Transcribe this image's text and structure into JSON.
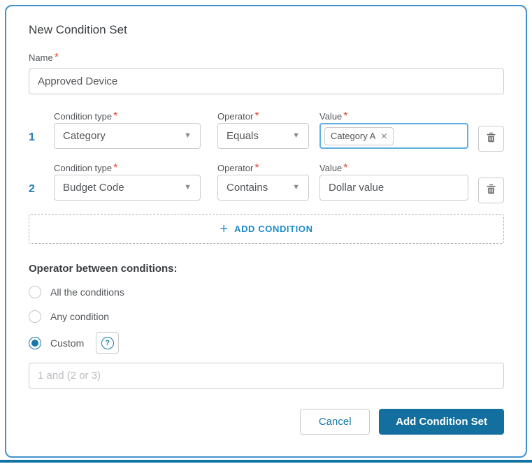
{
  "dialog": {
    "title": "New Condition Set",
    "required_mark": "*",
    "name_field": {
      "label": "Name",
      "value": "Approved Device"
    },
    "columns": {
      "condition_type": "Condition type",
      "operator": "Operator",
      "value": "Value"
    },
    "conditions": [
      {
        "index": "1",
        "condition_type": "Category",
        "operator": "Equals",
        "chip": "Category A"
      },
      {
        "index": "2",
        "condition_type": "Budget Code",
        "operator": "Contains",
        "value": "Dollar value"
      }
    ],
    "add_condition_label": "ADD CONDITION",
    "operator_between": {
      "label": "Operator between conditions:",
      "options": [
        {
          "label": "All the conditions",
          "selected": false
        },
        {
          "label": "Any condition",
          "selected": false
        },
        {
          "label": "Custom",
          "selected": true
        }
      ],
      "custom_placeholder": "1 and (2 or 3)"
    },
    "footer": {
      "cancel_label": "Cancel",
      "submit_label": "Add Condition Set"
    }
  },
  "icons": {
    "plus": "+",
    "chip_remove": "✕",
    "dropdown_arrow": "▼",
    "help": "?"
  },
  "colors": {
    "dialog_border": "#4191cb",
    "accent_blue": "#1779a8",
    "row_number_blue": "#1d7db3",
    "add_condition_blue": "#1e8bc8",
    "submit_button_bg": "#126f9e",
    "focus_border": "#5fafe0",
    "required_red": "#e5472d",
    "bottom_bar": "#1173a3"
  }
}
